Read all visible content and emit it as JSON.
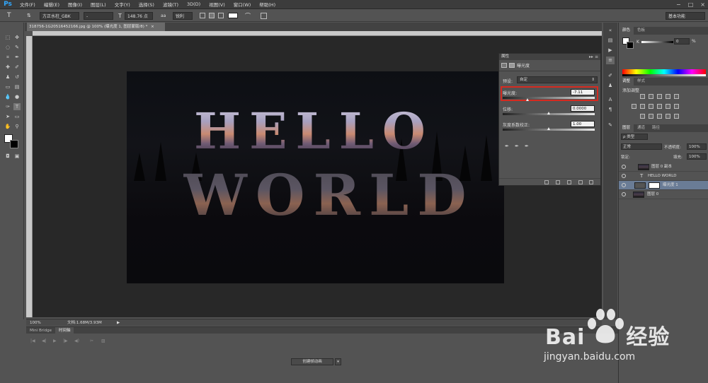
{
  "menubar": {
    "logo": "Ps",
    "items": [
      "文件(F)",
      "编辑(E)",
      "图像(I)",
      "图层(L)",
      "文字(Y)",
      "选择(S)",
      "滤镜(T)",
      "3D(D)",
      "视图(V)",
      "窗口(W)",
      "帮助(H)"
    ],
    "window_controls": [
      "−",
      "□",
      "×"
    ]
  },
  "optbar": {
    "tool_glyph": "T",
    "font_family": "方正水柱_GBK",
    "font_style": "-",
    "font_size": "148.76 点",
    "aa_label": "aa",
    "aa_mode": "锐利",
    "workspace": "基本功能"
  },
  "document": {
    "tab_title": "318756-1G20516452166.jpg @ 100% (曝光度 1, 图层蒙版/8) *",
    "close_glyph": "×",
    "text_line1": "HELLO",
    "text_line2": "WORLD"
  },
  "properties": {
    "panel_title": "属性",
    "adjustment_name": "曝光度",
    "preset_label": "预设:",
    "preset_value": "自定",
    "exposure_label": "曝光度:",
    "exposure_value": "-7.11",
    "offset_label": "位移:",
    "offset_value": "0.0000",
    "gamma_label": "灰度系数校正:",
    "gamma_value": "1.00",
    "exposure_level": 0.27,
    "offset_level": 0.5,
    "gamma_level": 0.5
  },
  "right_panels": {
    "color_tabs": [
      "颜色",
      "色板"
    ],
    "color_channel": "K",
    "color_value": "0",
    "color_unit": "%",
    "adjust_tabs": [
      "调整",
      "样式"
    ],
    "adjust_title": "添加调整",
    "layer_tabs": [
      "图层",
      "通道",
      "路径"
    ],
    "layer_filter": "ρ 类型",
    "blend_mode": "正常",
    "opacity_label": "不透明度:",
    "opacity_value": "100%",
    "lock_label": "锁定:",
    "fill_label": "填充:",
    "fill_value": "100%",
    "layers": [
      {
        "name": "图层 0 副本"
      },
      {
        "name": "HELLO WORLD"
      },
      {
        "name": "曝光度 1"
      },
      {
        "name": "图层 0"
      }
    ]
  },
  "status": {
    "zoom": "100%",
    "doc_info": "文档:1.68M/3.93M"
  },
  "timeline": {
    "tabs": [
      "Mini Bridge",
      "时间轴"
    ],
    "create_button": "创建帧动画"
  },
  "watermark": {
    "brand": "Bai",
    "brand_cn": "经验",
    "url": "jingyan.baidu.com"
  }
}
